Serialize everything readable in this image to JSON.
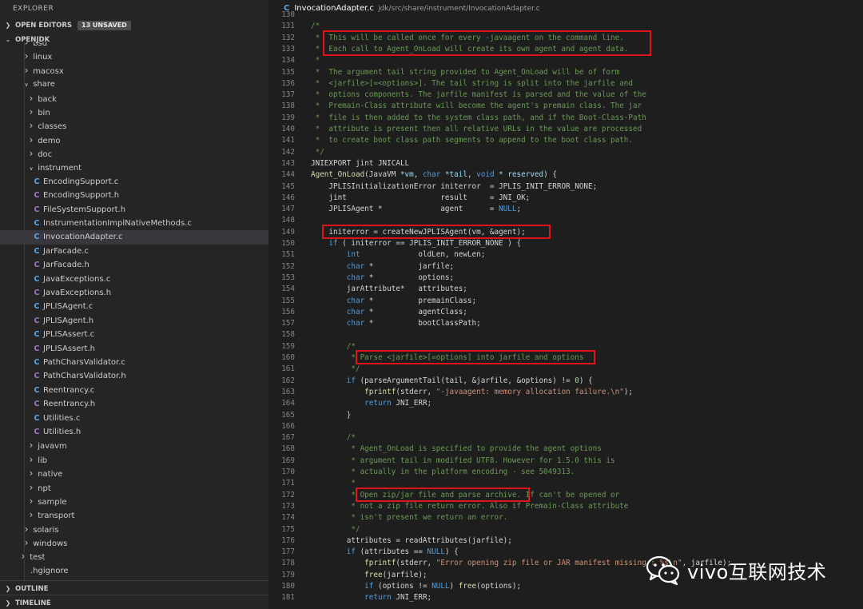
{
  "sidebar": {
    "title": "EXPLORER",
    "open_editors": {
      "label": "OPEN EDITORS",
      "badge": "13 UNSAVED"
    },
    "project": {
      "label": "OPENJDK"
    },
    "outline_label": "OUTLINE",
    "timeline_label": "TIMELINE",
    "tree": [
      {
        "label": "bsd",
        "kind": "folder",
        "depth": 2,
        "expanded": false
      },
      {
        "label": "linux",
        "kind": "folder",
        "depth": 2,
        "expanded": false
      },
      {
        "label": "macosx",
        "kind": "folder",
        "depth": 2,
        "expanded": false
      },
      {
        "label": "share",
        "kind": "folder",
        "depth": 2,
        "expanded": true
      },
      {
        "label": "back",
        "kind": "folder",
        "depth": 3,
        "expanded": false
      },
      {
        "label": "bin",
        "kind": "folder",
        "depth": 3,
        "expanded": false
      },
      {
        "label": "classes",
        "kind": "folder",
        "depth": 3,
        "expanded": false
      },
      {
        "label": "demo",
        "kind": "folder",
        "depth": 3,
        "expanded": false
      },
      {
        "label": "doc",
        "kind": "folder",
        "depth": 3,
        "expanded": false
      },
      {
        "label": "instrument",
        "kind": "folder",
        "depth": 3,
        "expanded": true
      },
      {
        "label": "EncodingSupport.c",
        "kind": "c",
        "depth": 4
      },
      {
        "label": "EncodingSupport.h",
        "kind": "h",
        "depth": 4
      },
      {
        "label": "FileSystemSupport.h",
        "kind": "h",
        "depth": 4
      },
      {
        "label": "InstrumentationImplNativeMethods.c",
        "kind": "c",
        "depth": 4
      },
      {
        "label": "InvocationAdapter.c",
        "kind": "c",
        "depth": 4,
        "selected": true
      },
      {
        "label": "JarFacade.c",
        "kind": "c",
        "depth": 4
      },
      {
        "label": "JarFacade.h",
        "kind": "h",
        "depth": 4
      },
      {
        "label": "JavaExceptions.c",
        "kind": "c",
        "depth": 4
      },
      {
        "label": "JavaExceptions.h",
        "kind": "h",
        "depth": 4
      },
      {
        "label": "JPLISAgent.c",
        "kind": "c",
        "depth": 4
      },
      {
        "label": "JPLISAgent.h",
        "kind": "h",
        "depth": 4
      },
      {
        "label": "JPLISAssert.c",
        "kind": "c",
        "depth": 4
      },
      {
        "label": "JPLISAssert.h",
        "kind": "h",
        "depth": 4
      },
      {
        "label": "PathCharsValidator.c",
        "kind": "c",
        "depth": 4
      },
      {
        "label": "PathCharsValidator.h",
        "kind": "h",
        "depth": 4
      },
      {
        "label": "Reentrancy.c",
        "kind": "c",
        "depth": 4
      },
      {
        "label": "Reentrancy.h",
        "kind": "h",
        "depth": 4
      },
      {
        "label": "Utilities.c",
        "kind": "c",
        "depth": 4
      },
      {
        "label": "Utilities.h",
        "kind": "h",
        "depth": 4
      },
      {
        "label": "javavm",
        "kind": "folder",
        "depth": 3,
        "expanded": false
      },
      {
        "label": "lib",
        "kind": "folder",
        "depth": 3,
        "expanded": false
      },
      {
        "label": "native",
        "kind": "folder",
        "depth": 3,
        "expanded": false
      },
      {
        "label": "npt",
        "kind": "folder",
        "depth": 3,
        "expanded": false
      },
      {
        "label": "sample",
        "kind": "folder",
        "depth": 3,
        "expanded": false
      },
      {
        "label": "transport",
        "kind": "folder",
        "depth": 3,
        "expanded": false
      },
      {
        "label": "solaris",
        "kind": "folder",
        "depth": 2,
        "expanded": false
      },
      {
        "label": "windows",
        "kind": "folder",
        "depth": 2,
        "expanded": false
      },
      {
        "label": "test",
        "kind": "folder",
        "depth": 1,
        "expanded": false
      },
      {
        "label": ".hgignore",
        "kind": "file",
        "depth": 1
      }
    ]
  },
  "editor": {
    "tab": {
      "icon": "C",
      "filename": "InvocationAdapter.c",
      "path": "jdk/src/share/instrument/InvocationAdapter.c"
    },
    "lines": [
      {
        "n": "130",
        "html": ""
      },
      {
        "n": "131",
        "html": "<span class=\"cm\">/*</span>"
      },
      {
        "n": "132",
        "html": "<span class=\"cm\"> *  This will be called once for every -javaagent on the command line.</span>"
      },
      {
        "n": "133",
        "html": "<span class=\"cm\"> *  Each call to Agent_OnLoad will create its own agent and agent data.</span>"
      },
      {
        "n": "134",
        "html": "<span class=\"cm\"> *</span>"
      },
      {
        "n": "135",
        "html": "<span class=\"cm\"> *  The argument tail string provided to Agent_OnLoad will be of form</span>"
      },
      {
        "n": "136",
        "html": "<span class=\"cm\"> *  &lt;jarfile&gt;[=&lt;options&gt;]. The tail string is split into the jarfile and</span>"
      },
      {
        "n": "137",
        "html": "<span class=\"cm\"> *  options components. The jarfile manifest is parsed and the value of the</span>"
      },
      {
        "n": "138",
        "html": "<span class=\"cm\"> *  Premain-Class attribute will become the agent's premain class. The jar</span>"
      },
      {
        "n": "139",
        "html": "<span class=\"cm\"> *  file is then added to the system class path, and if the Boot-Class-Path</span>"
      },
      {
        "n": "140",
        "html": "<span class=\"cm\"> *  attribute is present then all relative URLs in the value are processed</span>"
      },
      {
        "n": "141",
        "html": "<span class=\"cm\"> *  to create boot class path segments to append to the boot class path.</span>"
      },
      {
        "n": "142",
        "html": "<span class=\"cm\"> */</span>"
      },
      {
        "n": "143",
        "html": "JNIEXPORT jint JNICALL"
      },
      {
        "n": "144",
        "html": "<span class=\"fn\">Agent_OnLoad</span>(JavaVM <span class=\"vr\">*vm</span>, <span class=\"kw\">char</span> <span class=\"vr\">*tail</span>, <span class=\"kw\">void</span> <span class=\"vr\">* reserved</span>) {"
      },
      {
        "n": "145",
        "html": "    JPLISInitializationError initerror  = JPLIS_INIT_ERROR_NONE;"
      },
      {
        "n": "146",
        "html": "    jint                     result     = JNI_OK;"
      },
      {
        "n": "147",
        "html": "    JPLISAgent *             agent      = <span class=\"kw\">NULL</span>;"
      },
      {
        "n": "148",
        "html": ""
      },
      {
        "n": "149",
        "html": "    initerror = createNewJPLISAgent(vm, &amp;agent);"
      },
      {
        "n": "150",
        "html": "    <span class=\"kw\">if</span> ( initerror == JPLIS_INIT_ERROR_NONE ) {"
      },
      {
        "n": "151",
        "html": "        <span class=\"kw\">int</span>             oldLen, newLen;"
      },
      {
        "n": "152",
        "html": "        <span class=\"kw\">char</span> *          jarfile;"
      },
      {
        "n": "153",
        "html": "        <span class=\"kw\">char</span> *          options;"
      },
      {
        "n": "154",
        "html": "        jarAttribute*   attributes;"
      },
      {
        "n": "155",
        "html": "        <span class=\"kw\">char</span> *          premainClass;"
      },
      {
        "n": "156",
        "html": "        <span class=\"kw\">char</span> *          agentClass;"
      },
      {
        "n": "157",
        "html": "        <span class=\"kw\">char</span> *          bootClassPath;"
      },
      {
        "n": "158",
        "html": ""
      },
      {
        "n": "159",
        "html": "        <span class=\"cm\">/*</span>"
      },
      {
        "n": "160",
        "html": "<span class=\"cm\">         * Parse &lt;jarfile&gt;[=options] into jarfile and options</span>"
      },
      {
        "n": "161",
        "html": "<span class=\"cm\">         */</span>"
      },
      {
        "n": "162",
        "html": "        <span class=\"kw\">if</span> (parseArgumentTail(tail, &amp;jarfile, &amp;options) != <span class=\"nm\">0</span>) {"
      },
      {
        "n": "163",
        "html": "            <span class=\"fn\">fprintf</span>(stderr, <span class=\"st\">\"-javaagent: memory allocation failure.\\n\"</span>);"
      },
      {
        "n": "164",
        "html": "            <span class=\"kw\">return</span> JNI_ERR;"
      },
      {
        "n": "165",
        "html": "        }"
      },
      {
        "n": "166",
        "html": ""
      },
      {
        "n": "167",
        "html": "        <span class=\"cm\">/*</span>"
      },
      {
        "n": "168",
        "html": "<span class=\"cm\">         * Agent_OnLoad is specified to provide the agent options</span>"
      },
      {
        "n": "169",
        "html": "<span class=\"cm\">         * argument tail in modified UTF8. However for 1.5.0 this is</span>"
      },
      {
        "n": "170",
        "html": "<span class=\"cm\">         * actually in the platform encoding - see 5049313.</span>"
      },
      {
        "n": "171",
        "html": "<span class=\"cm\">         *</span>"
      },
      {
        "n": "172",
        "html": "<span class=\"cm\">         * Open zip/jar file and parse archive. If can't be opened or</span>"
      },
      {
        "n": "173",
        "html": "<span class=\"cm\">         * not a zip file return error. Also if Premain-Class attribute</span>"
      },
      {
        "n": "174",
        "html": "<span class=\"cm\">         * isn't present we return an error.</span>"
      },
      {
        "n": "175",
        "html": "<span class=\"cm\">         */</span>"
      },
      {
        "n": "176",
        "html": "        attributes = readAttributes(jarfile);"
      },
      {
        "n": "177",
        "html": "        <span class=\"kw\">if</span> (attributes == <span class=\"kw\">NULL</span>) {"
      },
      {
        "n": "178",
        "html": "            <span class=\"fn\">fprintf</span>(stderr, <span class=\"st\">\"Error opening zip file or JAR manifest missing : %s\\n\"</span>, jarfile);"
      },
      {
        "n": "179",
        "html": "            <span class=\"fn\">free</span>(jarfile);"
      },
      {
        "n": "180",
        "html": "            <span class=\"kw\">if</span> (options != <span class=\"kw\">NULL</span>) <span class=\"fn\">free</span>(options);"
      },
      {
        "n": "181",
        "html": "            <span class=\"kw\">return</span> JNI_ERR;"
      }
    ]
  },
  "watermark": {
    "text": "vivo互联网技术",
    "icon": "wechat-icon"
  }
}
